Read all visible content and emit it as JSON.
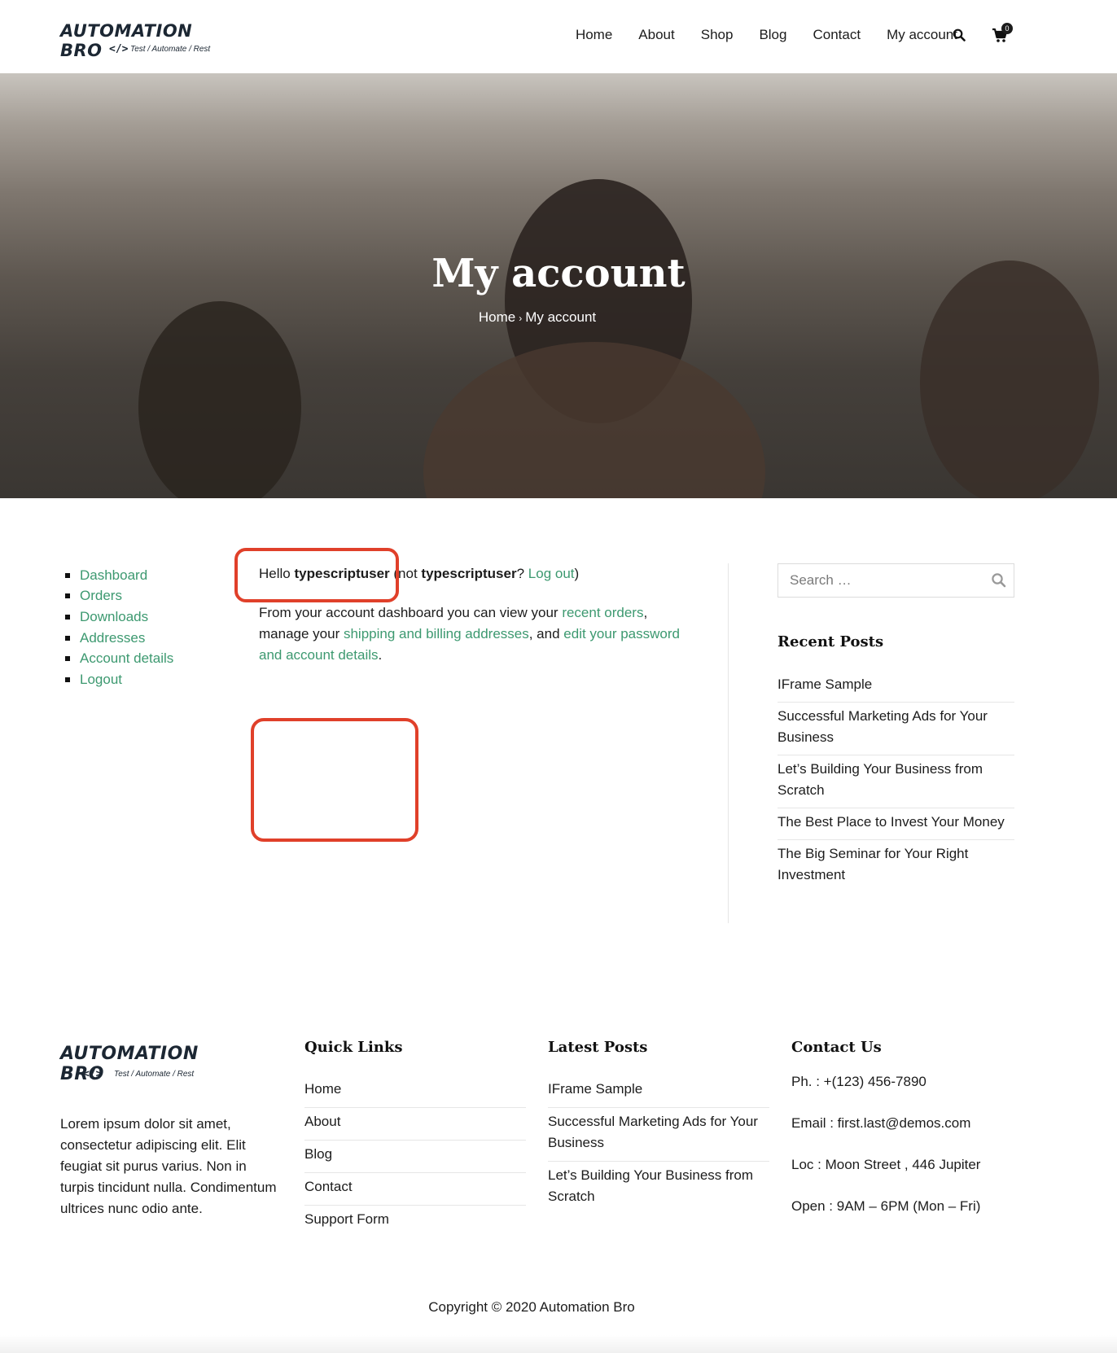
{
  "brand": {
    "name": "AUTOMATION BRO",
    "code_glyph": "</>",
    "tagline": "Test / Automate / Rest"
  },
  "nav": {
    "items": [
      "Home",
      "About",
      "Shop",
      "Blog",
      "Contact",
      "My account"
    ],
    "search_icon": "search-icon",
    "cart_icon": "cart-icon",
    "cart_count": "0"
  },
  "hero": {
    "title": "My account",
    "breadcrumb": {
      "home": "Home",
      "separator": "›",
      "current": "My account"
    }
  },
  "account_nav": {
    "items": [
      "Dashboard",
      "Orders",
      "Downloads",
      "Addresses",
      "Account details",
      "Logout"
    ]
  },
  "content": {
    "hello": "Hello",
    "username": "typescriptuser",
    "not_open": "(not",
    "username2": "typescriptuser",
    "q": "?",
    "logout": "Log out",
    "close": ")",
    "desc_1": "From your account dashboard you can view your",
    "recent_orders": "recent orders",
    "desc_2": ", manage your",
    "addresses": "shipping and billing addresses",
    "desc_3": ", and",
    "edit": "edit your password and account details",
    "desc_4": "."
  },
  "sidebar": {
    "search_placeholder": "Search …",
    "recent_title": "Recent Posts",
    "posts": [
      "IFrame Sample",
      "Successful Marketing Ads for Your Business",
      "Let’s Building Your Business from Scratch",
      "The Best Place to Invest Your Money",
      "The Big Seminar for Your Right Investment"
    ]
  },
  "footer": {
    "about": "Lorem ipsum dolor sit amet, consectetur adipiscing elit. Elit feugiat sit purus varius. Non in turpis tincidunt nulla. Condimentum ultrices nunc odio ante.",
    "quick_links_title": "Quick Links",
    "quick_links": [
      "Home",
      "About",
      "Blog",
      "Contact",
      "Support Form"
    ],
    "latest_title": "Latest Posts",
    "latest_posts": [
      "IFrame Sample",
      "Successful Marketing Ads for Your Business",
      "Let’s Building Your Business from Scratch"
    ],
    "contact_title": "Contact Us",
    "contact": [
      "Ph. : +(123) 456-7890",
      "Email : first.last@demos.com",
      "Loc : Moon Street , 446 Jupiter",
      "Open : 9AM – 6PM (Mon – Fri)"
    ],
    "copyright": "Copyright © 2020 Automation Bro"
  },
  "colors": {
    "link_green": "#3d9970",
    "annotation_red": "#e0402a",
    "text_dark": "#1c1c1c"
  }
}
